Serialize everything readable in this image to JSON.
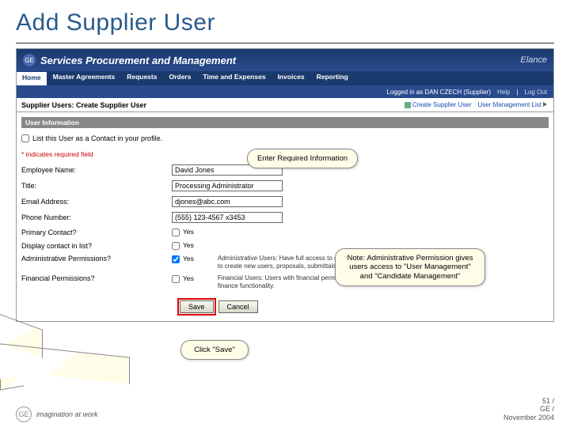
{
  "slide": {
    "title": "Add Supplier User"
  },
  "header": {
    "app_title": "Services Procurement and Management",
    "brand": "Elance"
  },
  "nav": {
    "tabs": [
      "Home",
      "Master Agreements",
      "Requests",
      "Orders",
      "Time and Expenses",
      "Invoices",
      "Reporting"
    ]
  },
  "userbar": {
    "logged_in": "Logged in as DAN CZECH (Supplier)",
    "help": "Help",
    "logout": "Log Out"
  },
  "page": {
    "title": "Supplier Users: Create Supplier User",
    "links": {
      "create": "Create Supplier User",
      "list": "User Management List"
    }
  },
  "form": {
    "section": "User Information",
    "list_contact": "List this User as a Contact in your profile.",
    "required_note": "* indicates required field",
    "fields": {
      "name_label": "Employee Name:",
      "name_value": "David Jones",
      "title_label": "Title:",
      "title_value": "Processing Administrator",
      "email_label": "Email Address:",
      "email_value": "djones@abc.com",
      "phone_label": "Phone Number:",
      "phone_value": "(555) 123-4567 x3453",
      "primary_label": "Primary Contact?",
      "primary_yes": "Yes",
      "display_label": "Display contact in list?",
      "display_yes": "Yes",
      "admin_label": "Administrative Permissions?",
      "admin_yes": "Yes",
      "admin_desc": "Administrative Users: Have full access to supplier functionality including the ability to create new users, proposals, submittals, and invoices (at all locations).",
      "finance_label": "Financial Permissions?",
      "finance_yes": "Yes",
      "finance_desc": "Financial Users: Users with financial permissions have full access to supplier finance functionality."
    },
    "buttons": {
      "save": "Save",
      "cancel": "Cancel"
    }
  },
  "callouts": {
    "enter": "Enter Required Information",
    "note": "Note: Administrative Permission gives users access to \"User Management\" and \"Candidate Management\"",
    "save": "Click \"Save\""
  },
  "footer": {
    "tagline": "imagination at work",
    "page": "51 /",
    "org": "GE /",
    "date": "November 2004"
  }
}
